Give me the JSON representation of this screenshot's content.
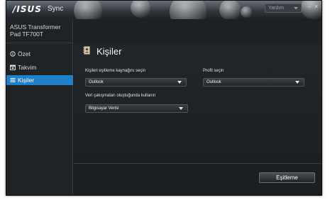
{
  "titlebar": {
    "brand": "/ISUS",
    "app_title": "Sync",
    "help_select": "Yardım",
    "minimize": "–",
    "close": "×"
  },
  "sidebar": {
    "device_name": "ASUS Transformer Pad TF700T",
    "items": [
      {
        "label": "Özet",
        "icon": "info-icon",
        "active": false
      },
      {
        "label": "Takvim",
        "icon": "calendar-icon",
        "active": false
      },
      {
        "label": "Kişiler",
        "icon": "contacts-icon",
        "active": true
      }
    ]
  },
  "main": {
    "title": "Kişiler",
    "source_label": "Kişileri eşitleme kaynağını seçin",
    "source_value": "Outlook",
    "profile_label": "Profil seçin",
    "profile_value": "Outlook",
    "conflict_label": "Veri çakışmaları oluştuğunda kullanın",
    "conflict_value": "Bilgisayar Verisi",
    "sync_button": "Eşitleme"
  },
  "colors": {
    "accent": "#1f7fc8",
    "background": "#1b1e21"
  }
}
